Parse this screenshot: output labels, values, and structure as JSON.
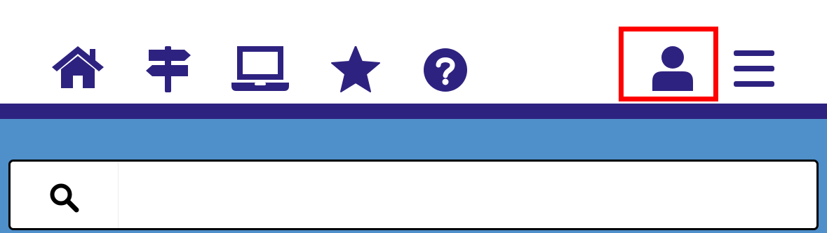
{
  "header": {
    "nav_icons": [
      {
        "name": "home-icon",
        "interactable": true
      },
      {
        "name": "signpost-icon",
        "interactable": true
      },
      {
        "name": "laptop-icon",
        "interactable": true
      },
      {
        "name": "star-icon",
        "interactable": true
      },
      {
        "name": "help-icon",
        "interactable": true
      }
    ],
    "account_icon": "user-icon",
    "menu_icon": "hamburger-menu-icon",
    "highlighted_item": "user-icon"
  },
  "search": {
    "icon": "search-icon",
    "placeholder": "",
    "value": ""
  },
  "colors": {
    "icon_color": "#2e2280",
    "divider": "#2e2280",
    "content_background": "#4f8fca",
    "highlight": "#ff0000"
  }
}
